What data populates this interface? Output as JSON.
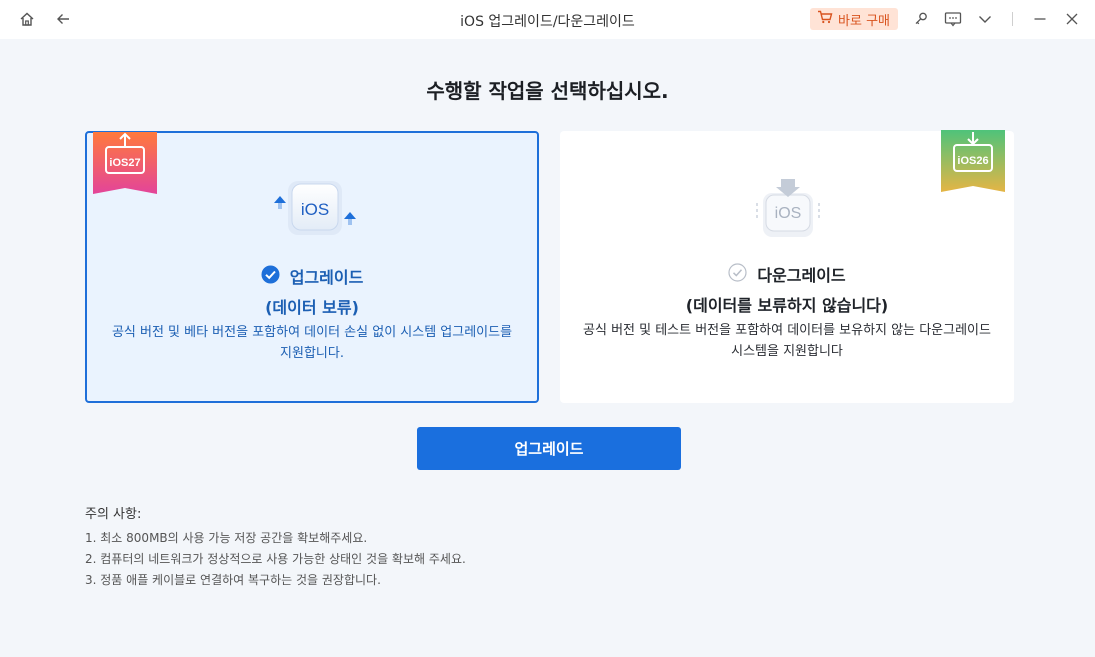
{
  "titlebar": {
    "title": "iOS 업그레이드/다운그레이드",
    "buy_label": "바로 구매",
    "icons": [
      "home-icon",
      "back-arrow-icon",
      "cart-icon",
      "key-icon",
      "feedback-icon",
      "chevron-down-icon",
      "minimize-icon",
      "close-icon"
    ]
  },
  "heading": "수행할 작업을 선택하십시오.",
  "options": [
    {
      "badge": "iOS27",
      "illus_text": "iOS",
      "title": "업그레이드",
      "subtitle": "(데이터 보류)",
      "description": "공식 버전 및 베타 버전을 포함하여 데이터 손실 없이 시스템 업그레이드를 지원합니다.",
      "selected": true
    },
    {
      "badge": "iOS26",
      "illus_text": "iOS",
      "title": "다운그레이드",
      "subtitle": "(데이터를 보류하지 않습니다)",
      "description": "공식 버전 및 테스트 버전을 포함하여 데이터를 보유하지 않는 다운그레이드 시스템을 지원합니다",
      "selected": false
    }
  ],
  "primary_button": "업그레이드",
  "notes": {
    "title": "주의 사항:",
    "items": [
      "1.  최소 800MB의 사용 가능 저장 공간을 확보해주세요.",
      "2.  컴퓨터의 네트워크가 정상적으로 사용 가능한 상태인 것을 확보해 주세요.",
      "3.  정품 애플 케이블로 연결하여 복구하는 것을 권장합니다."
    ]
  },
  "colors": {
    "accent": "#1a6fde",
    "selected_card_bg": "#eaf3fe",
    "buy_bg": "#ffe3d6",
    "buy_text": "#d9531e"
  }
}
